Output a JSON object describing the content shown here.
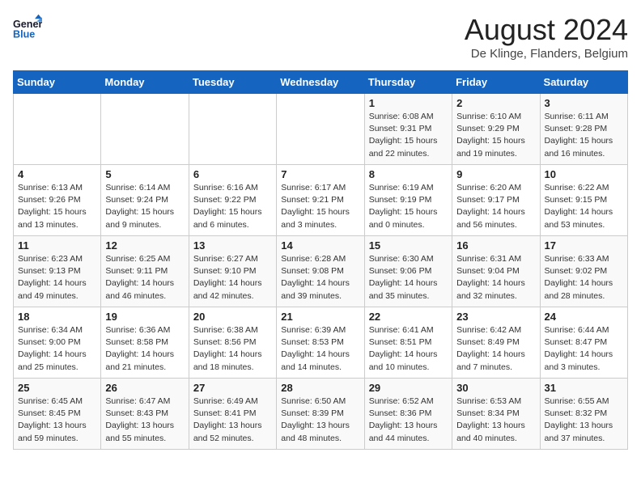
{
  "header": {
    "logo_line1": "General",
    "logo_line2": "Blue",
    "month": "August 2024",
    "location": "De Klinge, Flanders, Belgium"
  },
  "weekdays": [
    "Sunday",
    "Monday",
    "Tuesday",
    "Wednesday",
    "Thursday",
    "Friday",
    "Saturday"
  ],
  "weeks": [
    [
      {
        "day": "",
        "info": ""
      },
      {
        "day": "",
        "info": ""
      },
      {
        "day": "",
        "info": ""
      },
      {
        "day": "",
        "info": ""
      },
      {
        "day": "1",
        "info": "Sunrise: 6:08 AM\nSunset: 9:31 PM\nDaylight: 15 hours\nand 22 minutes."
      },
      {
        "day": "2",
        "info": "Sunrise: 6:10 AM\nSunset: 9:29 PM\nDaylight: 15 hours\nand 19 minutes."
      },
      {
        "day": "3",
        "info": "Sunrise: 6:11 AM\nSunset: 9:28 PM\nDaylight: 15 hours\nand 16 minutes."
      }
    ],
    [
      {
        "day": "4",
        "info": "Sunrise: 6:13 AM\nSunset: 9:26 PM\nDaylight: 15 hours\nand 13 minutes."
      },
      {
        "day": "5",
        "info": "Sunrise: 6:14 AM\nSunset: 9:24 PM\nDaylight: 15 hours\nand 9 minutes."
      },
      {
        "day": "6",
        "info": "Sunrise: 6:16 AM\nSunset: 9:22 PM\nDaylight: 15 hours\nand 6 minutes."
      },
      {
        "day": "7",
        "info": "Sunrise: 6:17 AM\nSunset: 9:21 PM\nDaylight: 15 hours\nand 3 minutes."
      },
      {
        "day": "8",
        "info": "Sunrise: 6:19 AM\nSunset: 9:19 PM\nDaylight: 15 hours\nand 0 minutes."
      },
      {
        "day": "9",
        "info": "Sunrise: 6:20 AM\nSunset: 9:17 PM\nDaylight: 14 hours\nand 56 minutes."
      },
      {
        "day": "10",
        "info": "Sunrise: 6:22 AM\nSunset: 9:15 PM\nDaylight: 14 hours\nand 53 minutes."
      }
    ],
    [
      {
        "day": "11",
        "info": "Sunrise: 6:23 AM\nSunset: 9:13 PM\nDaylight: 14 hours\nand 49 minutes."
      },
      {
        "day": "12",
        "info": "Sunrise: 6:25 AM\nSunset: 9:11 PM\nDaylight: 14 hours\nand 46 minutes."
      },
      {
        "day": "13",
        "info": "Sunrise: 6:27 AM\nSunset: 9:10 PM\nDaylight: 14 hours\nand 42 minutes."
      },
      {
        "day": "14",
        "info": "Sunrise: 6:28 AM\nSunset: 9:08 PM\nDaylight: 14 hours\nand 39 minutes."
      },
      {
        "day": "15",
        "info": "Sunrise: 6:30 AM\nSunset: 9:06 PM\nDaylight: 14 hours\nand 35 minutes."
      },
      {
        "day": "16",
        "info": "Sunrise: 6:31 AM\nSunset: 9:04 PM\nDaylight: 14 hours\nand 32 minutes."
      },
      {
        "day": "17",
        "info": "Sunrise: 6:33 AM\nSunset: 9:02 PM\nDaylight: 14 hours\nand 28 minutes."
      }
    ],
    [
      {
        "day": "18",
        "info": "Sunrise: 6:34 AM\nSunset: 9:00 PM\nDaylight: 14 hours\nand 25 minutes."
      },
      {
        "day": "19",
        "info": "Sunrise: 6:36 AM\nSunset: 8:58 PM\nDaylight: 14 hours\nand 21 minutes."
      },
      {
        "day": "20",
        "info": "Sunrise: 6:38 AM\nSunset: 8:56 PM\nDaylight: 14 hours\nand 18 minutes."
      },
      {
        "day": "21",
        "info": "Sunrise: 6:39 AM\nSunset: 8:53 PM\nDaylight: 14 hours\nand 14 minutes."
      },
      {
        "day": "22",
        "info": "Sunrise: 6:41 AM\nSunset: 8:51 PM\nDaylight: 14 hours\nand 10 minutes."
      },
      {
        "day": "23",
        "info": "Sunrise: 6:42 AM\nSunset: 8:49 PM\nDaylight: 14 hours\nand 7 minutes."
      },
      {
        "day": "24",
        "info": "Sunrise: 6:44 AM\nSunset: 8:47 PM\nDaylight: 14 hours\nand 3 minutes."
      }
    ],
    [
      {
        "day": "25",
        "info": "Sunrise: 6:45 AM\nSunset: 8:45 PM\nDaylight: 13 hours\nand 59 minutes."
      },
      {
        "day": "26",
        "info": "Sunrise: 6:47 AM\nSunset: 8:43 PM\nDaylight: 13 hours\nand 55 minutes."
      },
      {
        "day": "27",
        "info": "Sunrise: 6:49 AM\nSunset: 8:41 PM\nDaylight: 13 hours\nand 52 minutes."
      },
      {
        "day": "28",
        "info": "Sunrise: 6:50 AM\nSunset: 8:39 PM\nDaylight: 13 hours\nand 48 minutes."
      },
      {
        "day": "29",
        "info": "Sunrise: 6:52 AM\nSunset: 8:36 PM\nDaylight: 13 hours\nand 44 minutes."
      },
      {
        "day": "30",
        "info": "Sunrise: 6:53 AM\nSunset: 8:34 PM\nDaylight: 13 hours\nand 40 minutes."
      },
      {
        "day": "31",
        "info": "Sunrise: 6:55 AM\nSunset: 8:32 PM\nDaylight: 13 hours\nand 37 minutes."
      }
    ]
  ]
}
